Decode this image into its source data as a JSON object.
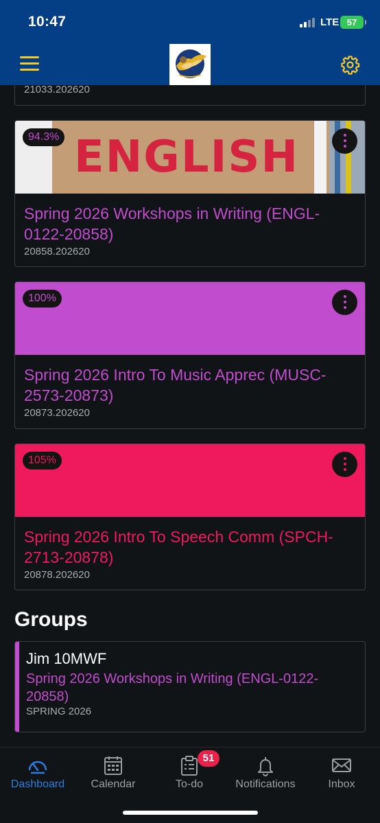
{
  "status_bar": {
    "time": "10:47",
    "network": "LTE",
    "battery": "57"
  },
  "app_bar": {
    "menu_icon": "hamburger-menu-icon",
    "settings_icon": "gear-icon",
    "accent_color": "#f5c92b",
    "background_color": "#043f86"
  },
  "courses": [
    {
      "code": "21033.202620"
    },
    {
      "grade": "94.3%",
      "title": "Spring 2026 Workshops in Writing (ENGL-0122-20858)",
      "code": "20858.202620",
      "color": "#c14ccd",
      "image_text": "ENGLISH"
    },
    {
      "grade": "100%",
      "title": "Spring 2026 Intro To Music Apprec (MUSC-2573-20873)",
      "code": "20873.202620",
      "color": "#c14ccd"
    },
    {
      "grade": "105%",
      "title": "Spring 2026 Intro To Speech Comm (SPCH-2713-20878)",
      "code": "20878.202620",
      "color": "#ef1a5d"
    }
  ],
  "groups": {
    "heading": "Groups",
    "items": [
      {
        "name": "Jim 10MWF",
        "course": "Spring 2026 Workshops in Writing (ENGL-0122-20858)",
        "term": "SPRING 2026"
      }
    ]
  },
  "tab_bar": {
    "tabs": [
      {
        "label": "Dashboard",
        "icon": "dashboard-gauge-icon",
        "active": true
      },
      {
        "label": "Calendar",
        "icon": "calendar-icon"
      },
      {
        "label": "To-do",
        "icon": "clipboard-icon",
        "badge": "51"
      },
      {
        "label": "Notifications",
        "icon": "bell-icon"
      },
      {
        "label": "Inbox",
        "icon": "envelope-icon"
      }
    ]
  }
}
